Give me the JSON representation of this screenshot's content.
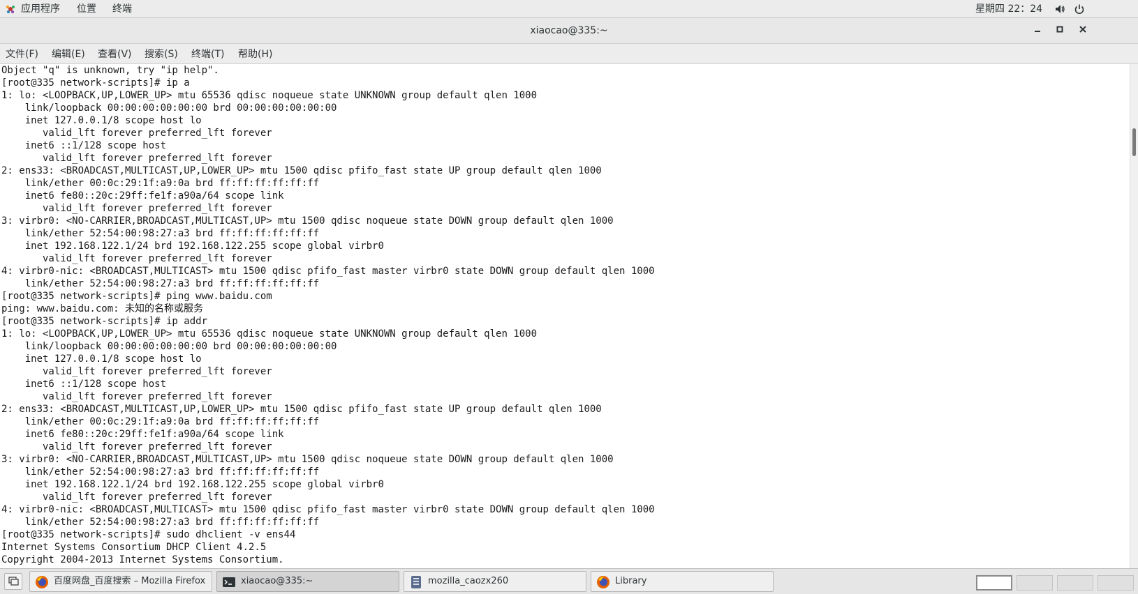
{
  "top_panel": {
    "applications": "应用程序",
    "places": "位置",
    "terminal": "终端",
    "clock": "星期四 22：24"
  },
  "window": {
    "title": "xiaocao@335:~"
  },
  "menubar": {
    "items": [
      "文件(F)",
      "编辑(E)",
      "查看(V)",
      "搜索(S)",
      "终端(T)",
      "帮助(H)"
    ]
  },
  "terminal": {
    "lines": [
      "Object \"q\" is unknown, try \"ip help\".",
      "[root@335 network-scripts]# ip a",
      "1: lo: <LOOPBACK,UP,LOWER_UP> mtu 65536 qdisc noqueue state UNKNOWN group default qlen 1000",
      "    link/loopback 00:00:00:00:00:00 brd 00:00:00:00:00:00",
      "    inet 127.0.0.1/8 scope host lo",
      "       valid_lft forever preferred_lft forever",
      "    inet6 ::1/128 scope host",
      "       valid_lft forever preferred_lft forever",
      "2: ens33: <BROADCAST,MULTICAST,UP,LOWER_UP> mtu 1500 qdisc pfifo_fast state UP group default qlen 1000",
      "    link/ether 00:0c:29:1f:a9:0a brd ff:ff:ff:ff:ff:ff",
      "    inet6 fe80::20c:29ff:fe1f:a90a/64 scope link",
      "       valid_lft forever preferred_lft forever",
      "3: virbr0: <NO-CARRIER,BROADCAST,MULTICAST,UP> mtu 1500 qdisc noqueue state DOWN group default qlen 1000",
      "    link/ether 52:54:00:98:27:a3 brd ff:ff:ff:ff:ff:ff",
      "    inet 192.168.122.1/24 brd 192.168.122.255 scope global virbr0",
      "       valid_lft forever preferred_lft forever",
      "4: virbr0-nic: <BROADCAST,MULTICAST> mtu 1500 qdisc pfifo_fast master virbr0 state DOWN group default qlen 1000",
      "    link/ether 52:54:00:98:27:a3 brd ff:ff:ff:ff:ff:ff",
      "[root@335 network-scripts]# ping www.baidu.com",
      "ping: www.baidu.com: 未知的名称或服务",
      "[root@335 network-scripts]# ip addr",
      "1: lo: <LOOPBACK,UP,LOWER_UP> mtu 65536 qdisc noqueue state UNKNOWN group default qlen 1000",
      "    link/loopback 00:00:00:00:00:00 brd 00:00:00:00:00:00",
      "    inet 127.0.0.1/8 scope host lo",
      "       valid_lft forever preferred_lft forever",
      "    inet6 ::1/128 scope host",
      "       valid_lft forever preferred_lft forever",
      "2: ens33: <BROADCAST,MULTICAST,UP,LOWER_UP> mtu 1500 qdisc pfifo_fast state UP group default qlen 1000",
      "    link/ether 00:0c:29:1f:a9:0a brd ff:ff:ff:ff:ff:ff",
      "    inet6 fe80::20c:29ff:fe1f:a90a/64 scope link",
      "       valid_lft forever preferred_lft forever",
      "3: virbr0: <NO-CARRIER,BROADCAST,MULTICAST,UP> mtu 1500 qdisc noqueue state DOWN group default qlen 1000",
      "    link/ether 52:54:00:98:27:a3 brd ff:ff:ff:ff:ff:ff",
      "    inet 192.168.122.1/24 brd 192.168.122.255 scope global virbr0",
      "       valid_lft forever preferred_lft forever",
      "4: virbr0-nic: <BROADCAST,MULTICAST> mtu 1500 qdisc pfifo_fast master virbr0 state DOWN group default qlen 1000",
      "    link/ether 52:54:00:98:27:a3 brd ff:ff:ff:ff:ff:ff",
      "[root@335 network-scripts]# sudo dhclient -v ens44",
      "Internet Systems Consortium DHCP Client 4.2.5",
      "Copyright 2004-2013 Internet Systems Consortium."
    ]
  },
  "taskbar": {
    "tasks": [
      {
        "label": "百度网盘_百度搜索 – Mozilla Firefox",
        "icon": "firefox-icon"
      },
      {
        "label": "xiaocao@335:~",
        "icon": "terminal-icon"
      },
      {
        "label": "mozilla_caozx260",
        "icon": "file-manager-icon"
      },
      {
        "label": "Library",
        "icon": "firefox-icon"
      }
    ]
  },
  "colors": {
    "panel_bg": "#ececec",
    "terminal_bg": "#ffffff",
    "terminal_fg": "#1a1a1a",
    "taskbar_bg": "#e6e6e6"
  }
}
